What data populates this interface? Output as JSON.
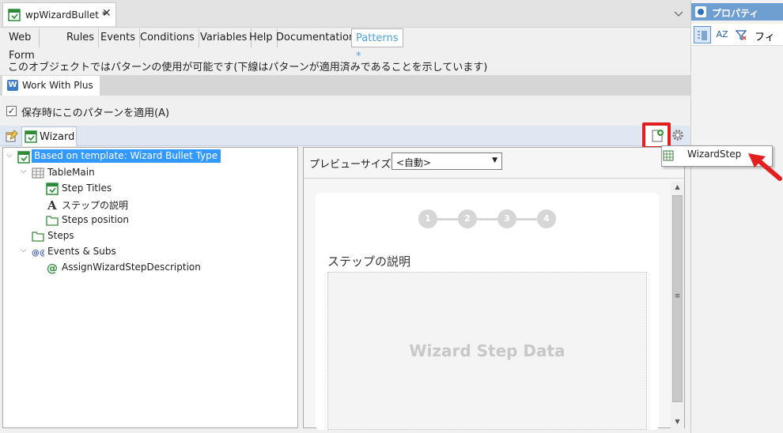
{
  "doc_tab": {
    "title": "wpWizardBullet *",
    "close": "✕"
  },
  "subtabs": [
    "Web Form",
    "Rules",
    "Events",
    "Conditions",
    "Variables",
    "Help",
    "Documentation",
    "Patterns *"
  ],
  "info_text": "このオブジェクトではパターンの使用が可能です(下線はパターンが適用済みであることを示しています)",
  "pattern_tab": {
    "label": "Work With Plus",
    "icon_letter": "W"
  },
  "apply_checkbox": {
    "label": "保存時にこのパターンを適用(A)",
    "checked": true,
    "mark": "✓"
  },
  "wizard_tab": {
    "label": "Wizard"
  },
  "properties": {
    "title": "プロパティ",
    "az_label": "AZ",
    "truncated_label": "フィ"
  },
  "tree": [
    {
      "label": "Based on template: Wizard Bullet Type",
      "icon": "wizard-icon",
      "depth": 0,
      "twisty": "⌵",
      "selected": true
    },
    {
      "label": "TableMain",
      "icon": "table-icon",
      "depth": 1,
      "twisty": "⌵",
      "selected": false
    },
    {
      "label": "Step Titles",
      "icon": "wizard-icon",
      "depth": 2,
      "twisty": "",
      "selected": false
    },
    {
      "label": "ステップの説明",
      "icon": "text-a-icon",
      "depth": 2,
      "twisty": "",
      "selected": false
    },
    {
      "label": "Steps position",
      "icon": "folder-icon",
      "depth": 2,
      "twisty": "",
      "selected": false
    },
    {
      "label": "Steps",
      "icon": "folder-icon",
      "depth": 1,
      "twisty": "",
      "selected": false
    },
    {
      "label": "Events & Subs",
      "icon": "events-icon",
      "depth": 1,
      "twisty": "⌵",
      "selected": false
    },
    {
      "label": "AssignWizardStepDescription",
      "icon": "at-icon",
      "depth": 2,
      "twisty": "",
      "selected": false
    }
  ],
  "preview": {
    "size_label": "プレビューサイズ",
    "size_value": "<自動>",
    "steps": [
      "1",
      "2",
      "3",
      "4"
    ],
    "step_description": "ステップの説明",
    "data_placeholder": "Wizard Step Data"
  },
  "dropdown_menu": {
    "item": "WizardStep"
  },
  "colors": {
    "accent": "#3399ff",
    "highlight_red": "#e21e1e",
    "wizard_bar": "#dfe7f3"
  }
}
